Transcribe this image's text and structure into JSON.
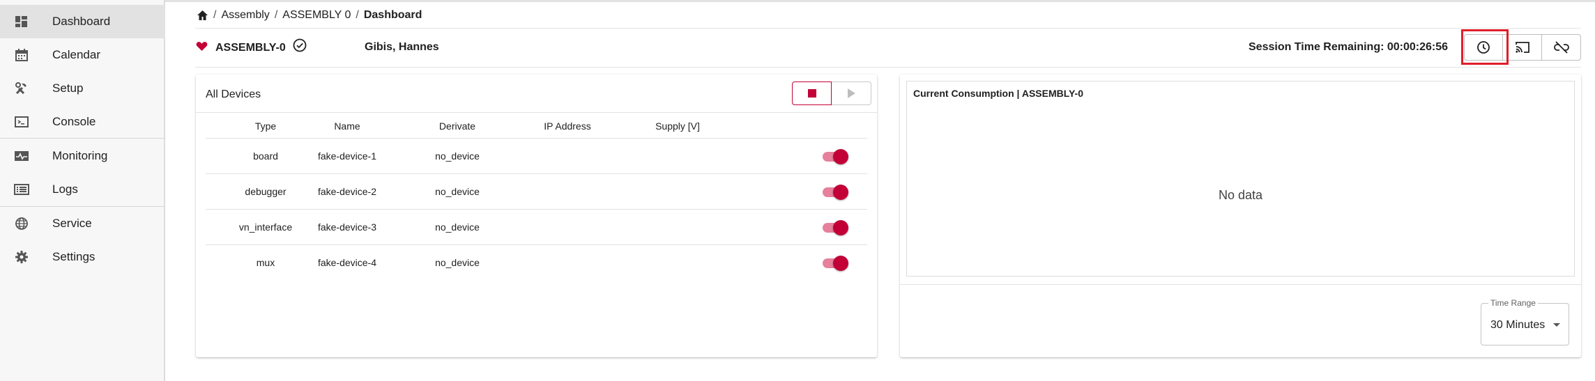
{
  "sidebar": {
    "items": [
      {
        "label": "Dashboard",
        "icon": "dashboard-icon",
        "active": true
      },
      {
        "label": "Calendar",
        "icon": "calendar-icon"
      },
      {
        "label": "Setup",
        "icon": "tools-icon"
      },
      {
        "label": "Console",
        "icon": "terminal-icon"
      },
      {
        "label": "Monitoring",
        "icon": "monitor-heartbeat-icon"
      },
      {
        "label": "Logs",
        "icon": "list-icon"
      },
      {
        "label": "Service",
        "icon": "globe-icon"
      },
      {
        "label": "Settings",
        "icon": "gear-icon"
      }
    ]
  },
  "breadcrumb": {
    "items": [
      "Assembly",
      "ASSEMBLY 0",
      "Dashboard"
    ],
    "separator": "/"
  },
  "header": {
    "assembly": "ASSEMBLY-0",
    "user": "Gibis, Hannes",
    "session": "Session Time Remaining: 00:00:26:56",
    "buttons": [
      "clock-icon",
      "cast-icon",
      "unlink-icon"
    ]
  },
  "devices": {
    "title": "All Devices",
    "columns": [
      "Type",
      "Name",
      "Derivate",
      "IP Address",
      "Supply [V]"
    ],
    "rows": [
      {
        "type": "board",
        "name": "fake-device-1",
        "derivate": "no_device",
        "ip": "",
        "supply": "",
        "enabled": true
      },
      {
        "type": "debugger",
        "name": "fake-device-2",
        "derivate": "no_device",
        "ip": "",
        "supply": "",
        "enabled": true
      },
      {
        "type": "vn_interface",
        "name": "fake-device-3",
        "derivate": "no_device",
        "ip": "",
        "supply": "",
        "enabled": true
      },
      {
        "type": "mux",
        "name": "fake-device-4",
        "derivate": "no_device",
        "ip": "",
        "supply": "",
        "enabled": true
      }
    ]
  },
  "consumption": {
    "title": "Current Consumption | ASSEMBLY-0",
    "empty_text": "No data",
    "time_range_label": "Time Range",
    "time_range_value": "30 Minutes"
  },
  "colors": {
    "accent": "#c20037",
    "toggle_track": "#e6809b",
    "highlight": "#e01e2a"
  }
}
